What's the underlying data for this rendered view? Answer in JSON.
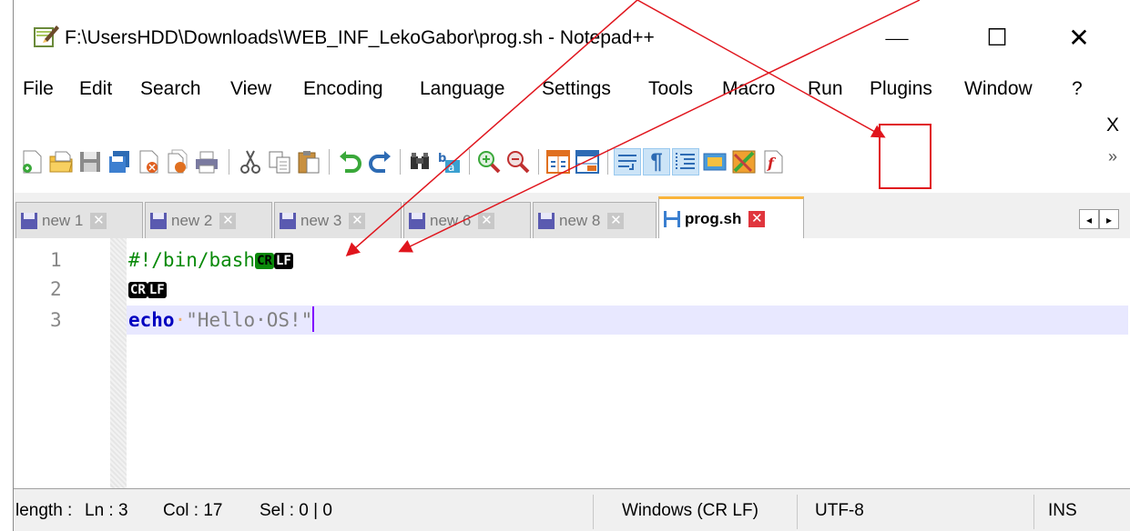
{
  "window": {
    "title": "F:\\UsersHDD\\Downloads\\WEB_INF_LekoGabor\\prog.sh - Notepad++",
    "minimize_glyph": "—",
    "maximize_glyph": "☐",
    "close_glyph": "✕"
  },
  "menu": {
    "items": [
      "File",
      "Edit",
      "Search",
      "View",
      "Encoding",
      "Language",
      "Settings",
      "Tools",
      "Macro",
      "Run",
      "Plugins",
      "Window",
      "?"
    ],
    "close_label": "X"
  },
  "toolbar": {
    "icons": [
      "new-file-icon",
      "open-file-icon",
      "save-icon",
      "save-all-icon",
      "close-icon",
      "close-all-icon",
      "print-icon",
      "cut-icon",
      "copy-icon",
      "paste-icon",
      "undo-icon",
      "redo-icon",
      "find-icon",
      "replace-icon",
      "zoom-in-icon",
      "zoom-out-icon",
      "sync-vertical-icon",
      "sync-horizontal-icon",
      "word-wrap-icon",
      "show-all-characters-icon",
      "indent-guide-icon",
      "doc-map-icon",
      "function-list-icon",
      "macro-record-icon"
    ],
    "more_glyph": "»",
    "show_all_characters_glyph": "¶"
  },
  "tabs": [
    {
      "label": "new 1",
      "active": false
    },
    {
      "label": "new 2",
      "active": false
    },
    {
      "label": "new 3",
      "active": false
    },
    {
      "label": "new 6",
      "active": false
    },
    {
      "label": "new 8",
      "active": false
    },
    {
      "label": "prog.sh",
      "active": true
    }
  ],
  "tab_close_glyph": "✕",
  "tab_scroll": {
    "left": "◂",
    "right": "▸"
  },
  "editor": {
    "lines": [
      {
        "number": "1",
        "code": "#!/bin/bash",
        "eol": [
          "CR",
          "LF"
        ]
      },
      {
        "number": "2",
        "code": "",
        "eol": [
          "CR",
          "LF"
        ]
      },
      {
        "number": "3",
        "keyword": "echo",
        "space_marker": "·",
        "string": "\"Hello·OS!\"",
        "eol": []
      }
    ]
  },
  "status": {
    "length_label": "length :",
    "ln": "Ln : 3",
    "col": "Col : 17",
    "sel": "Sel : 0 | 0",
    "eol_format": "Windows (CR LF)",
    "encoding": "UTF-8",
    "mode": "INS"
  },
  "colors": {
    "annotation_red": "#e0151d",
    "active_tab_accent": "#fab43a",
    "comment_green": "#098a0a",
    "keyword_blue": "#0000c0",
    "current_line": "#e8e8ff"
  }
}
